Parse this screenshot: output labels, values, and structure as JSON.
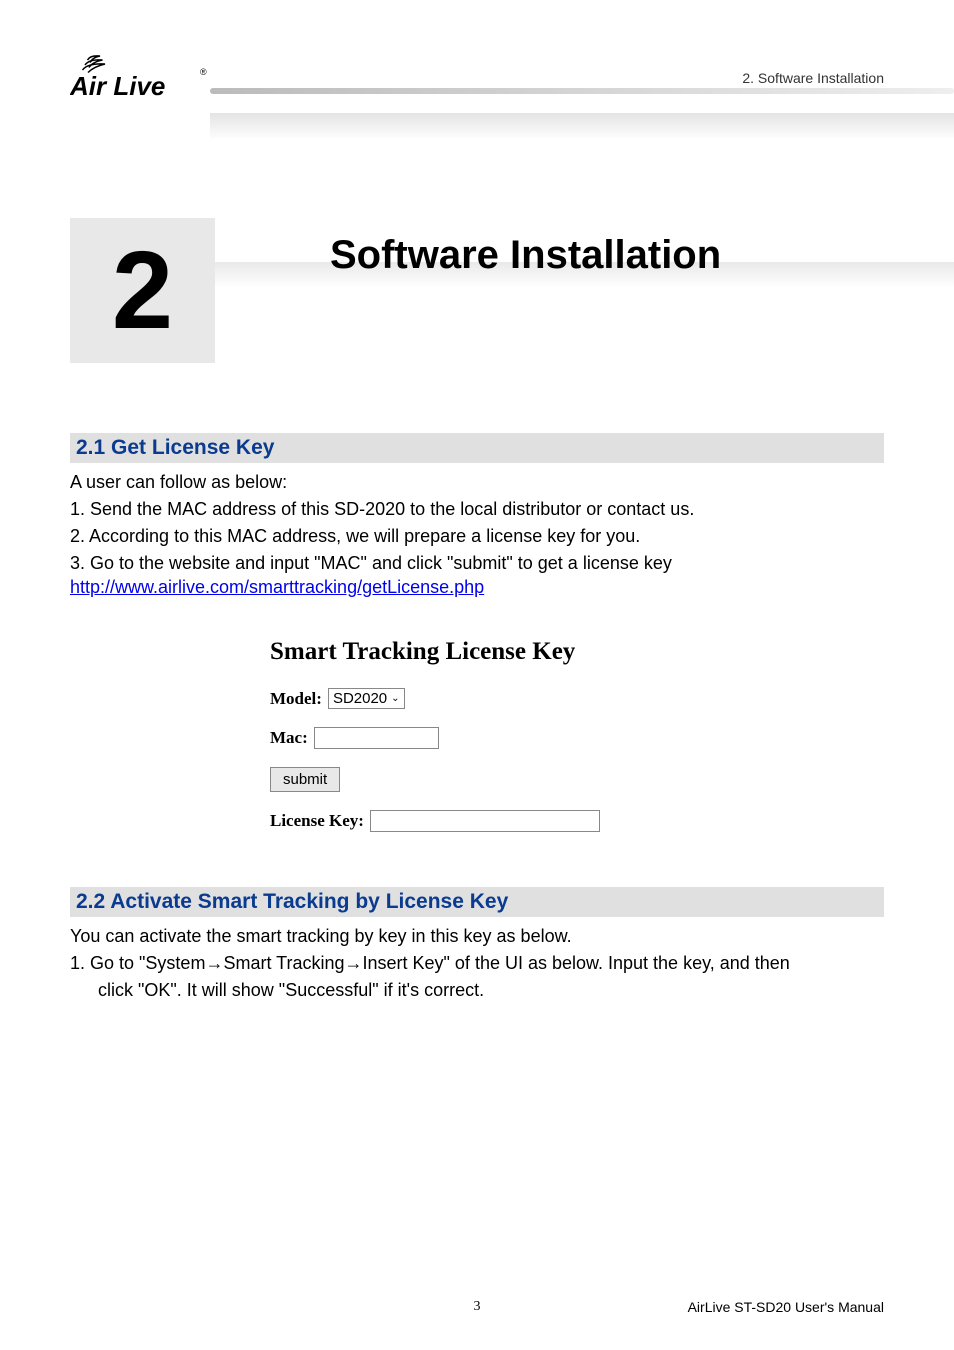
{
  "header": {
    "breadcrumb": "2.  Software  Installation",
    "logo_text": "Air Live",
    "logo_reg": "®"
  },
  "chapter": {
    "number": "2",
    "title": "Software Installation"
  },
  "section21": {
    "heading": "2.1 Get License Key",
    "intro": "A user can follow as below:",
    "step1": "1. Send the MAC address of this SD-2020 to the local distributor or contact us.",
    "step2": "2. According to this MAC address, we will prepare a license key for you.",
    "step3": "3. Go to the website and input \"MAC\" and click \"submit\" to get a license key",
    "link": "http://www.airlive.com/smarttracking/getLicense.php"
  },
  "form": {
    "title": "Smart Tracking License Key",
    "model_label": "Model:",
    "model_value": "SD2020",
    "mac_label": "Mac:",
    "submit_label": "submit",
    "license_label": "License Key:"
  },
  "section22": {
    "heading": "2.2 Activate Smart Tracking by License Key",
    "intro": "You can activate the smart tracking by key in this key as below.",
    "step1a": "1.  Go to \"System",
    "arrow": "→",
    "step1b": "Smart Tracking",
    "step1c": "Insert Key\" of the UI as below. Input the key, and then",
    "step1d": "click \"OK\". It will show \"Successful\" if it's correct."
  },
  "footer": {
    "page": "3",
    "text": "AirLive  ST-SD20  User's  Manual"
  }
}
